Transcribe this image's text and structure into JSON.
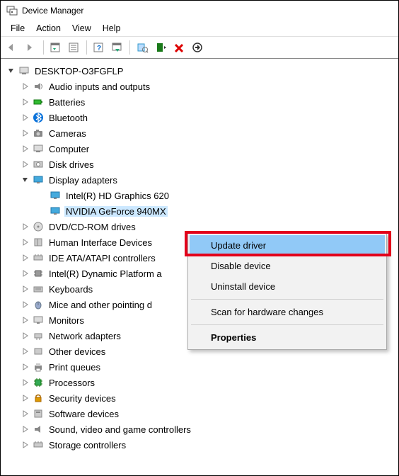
{
  "window": {
    "title": "Device Manager"
  },
  "menu": {
    "file": "File",
    "action": "Action",
    "view": "View",
    "help": "Help"
  },
  "tree": {
    "root": "DESKTOP-O3FGFLP",
    "items": [
      {
        "label": "Audio inputs and outputs"
      },
      {
        "label": "Batteries"
      },
      {
        "label": "Bluetooth"
      },
      {
        "label": "Cameras"
      },
      {
        "label": "Computer"
      },
      {
        "label": "Disk drives"
      },
      {
        "label": "Display adapters"
      },
      {
        "label": "DVD/CD-ROM drives"
      },
      {
        "label": "Human Interface Devices"
      },
      {
        "label": "IDE ATA/ATAPI controllers"
      },
      {
        "label": "Intel(R) Dynamic Platform a"
      },
      {
        "label": "Keyboards"
      },
      {
        "label": "Mice and other pointing d"
      },
      {
        "label": "Monitors"
      },
      {
        "label": "Network adapters"
      },
      {
        "label": "Other devices"
      },
      {
        "label": "Print queues"
      },
      {
        "label": "Processors"
      },
      {
        "label": "Security devices"
      },
      {
        "label": "Software devices"
      },
      {
        "label": "Sound, video and game controllers"
      },
      {
        "label": "Storage controllers"
      }
    ],
    "display_children": [
      {
        "label": "Intel(R) HD Graphics 620"
      },
      {
        "label": "NVIDIA GeForce 940MX"
      }
    ]
  },
  "contextmenu": {
    "update": "Update driver",
    "disable": "Disable device",
    "uninstall": "Uninstall device",
    "scan": "Scan for hardware changes",
    "properties": "Properties"
  }
}
